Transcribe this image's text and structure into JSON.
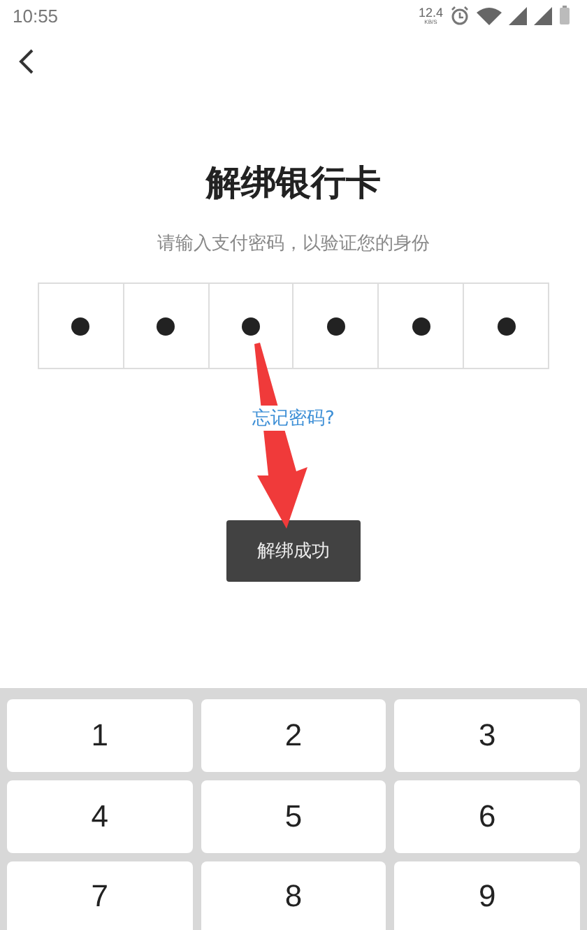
{
  "status_bar": {
    "time": "10:55",
    "net_speed": "12.4",
    "net_speed_unit": "KB/S"
  },
  "title": "解绑银行卡",
  "subtitle": "请输入支付密码，以验证您的身份",
  "pin_cells": [
    {
      "filled": true
    },
    {
      "filled": true
    },
    {
      "filled": true
    },
    {
      "filled": true
    },
    {
      "filled": true
    },
    {
      "filled": true
    }
  ],
  "forgot_link": "忘记密码?",
  "toast": "解绑成功",
  "keypad": {
    "keys": [
      "1",
      "2",
      "3",
      "4",
      "5",
      "6",
      "7",
      "8",
      "9"
    ]
  }
}
